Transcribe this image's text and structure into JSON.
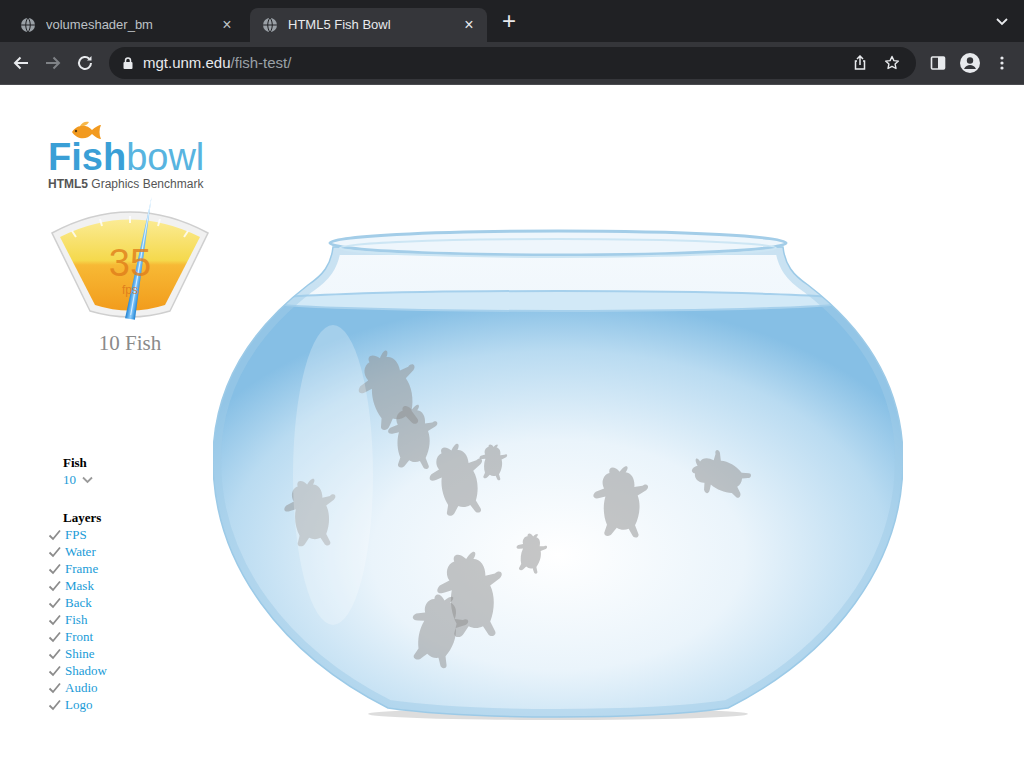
{
  "browser": {
    "tabs": [
      {
        "label": "volumeshader_bm",
        "close": "×",
        "selected": false
      },
      {
        "label": "HTML5 Fish Bowl",
        "close": "×",
        "selected": true
      }
    ],
    "new_tab": "+",
    "address": {
      "host": "mgt.unm.edu",
      "path": "/fish-test/"
    }
  },
  "logo": {
    "bold": "Fish",
    "light": "bowl",
    "subtitle_bold": "HTML5",
    "subtitle": "Graphics Benchmark"
  },
  "gauge": {
    "value": "35",
    "unit": "fps",
    "level": 0.6
  },
  "fish_count_label": "10 Fish",
  "controls": {
    "fish": {
      "label": "Fish",
      "value": "10"
    },
    "layers": {
      "label": "Layers",
      "items": [
        {
          "label": "FPS",
          "checked": true
        },
        {
          "label": "Water",
          "checked": true
        },
        {
          "label": "Frame",
          "checked": true
        },
        {
          "label": "Mask",
          "checked": true
        },
        {
          "label": "Back",
          "checked": true
        },
        {
          "label": "Fish",
          "checked": true
        },
        {
          "label": "Front",
          "checked": true
        },
        {
          "label": "Shine",
          "checked": true
        },
        {
          "label": "Shadow",
          "checked": true
        },
        {
          "label": "Audio",
          "checked": true
        },
        {
          "label": "Logo",
          "checked": true
        }
      ]
    }
  }
}
